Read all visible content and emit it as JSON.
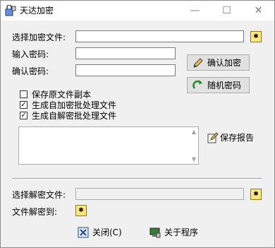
{
  "window": {
    "title": "天达加密",
    "minimize_glyph": "—",
    "maximize_glyph": "☐",
    "close_glyph": "✕"
  },
  "encrypt": {
    "select_file_label": "选择加密文件:",
    "select_file_value": "",
    "password_label": "输入密码:",
    "password_value": "",
    "confirm_label": "确认密码:",
    "confirm_value": "",
    "confirm_encrypt_button": "确认加密",
    "random_password_button": "随机密码"
  },
  "options": [
    {
      "label": "保存原文件副本",
      "checked": false
    },
    {
      "label": "生成自加密批处理文件",
      "checked": true
    },
    {
      "label": "生成自解密批处理文件",
      "checked": true
    }
  ],
  "report": {
    "text": "",
    "save_report_button": "保存报告"
  },
  "decrypt": {
    "select_file_label": "选择解密文件:",
    "select_file_value": "",
    "decrypt_to_label": "文件解密到:"
  },
  "footer": {
    "close_button": "关闭(C)",
    "about_button": "关于程序"
  },
  "icons": {
    "app": "lock-app-icon",
    "folder": "folder-star-icon",
    "pencil": "pencil-icon",
    "refresh": "refresh-arrow-icon",
    "save_report": "pencil-note-icon",
    "close": "close-x-icon",
    "about": "monitor-icon"
  },
  "colors": {
    "window_bg": "#f0f0f0",
    "titlebar_bg": "#ffffff",
    "folder_icon": "#ffe680"
  }
}
